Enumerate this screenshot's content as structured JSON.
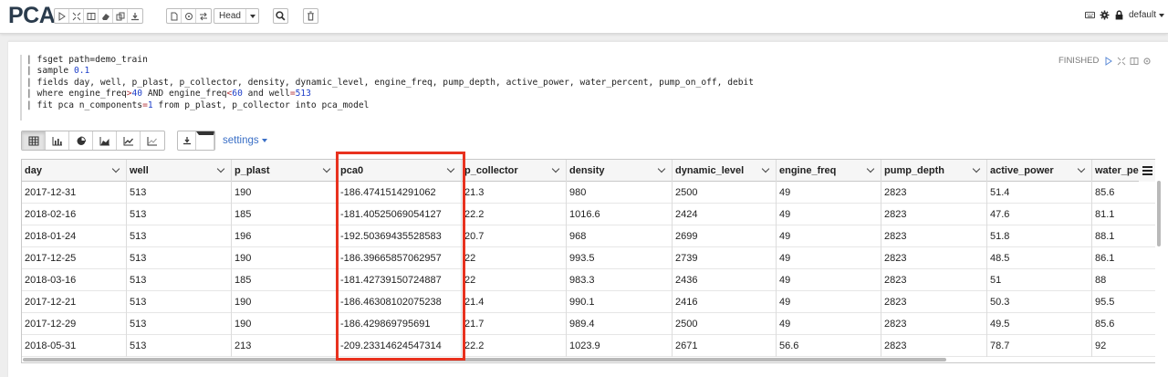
{
  "app": {
    "title": "PCA",
    "head_select": "Head",
    "default_select": "default"
  },
  "toolbar_icons": [
    "play-icon",
    "expand-icon",
    "book-icon",
    "eraser-icon",
    "copy-icon",
    "download-icon",
    "document-icon",
    "circle-icon",
    "swap-icon",
    "search-icon",
    "trash-icon"
  ],
  "right_icons": [
    "keyboard-icon",
    "gear-icon",
    "lock-icon"
  ],
  "paragraph": {
    "status": "FINISHED",
    "code_lines": [
      [
        {
          "t": "| fsget path=demo_train",
          "c": ""
        }
      ],
      [
        {
          "t": "| sample ",
          "c": ""
        },
        {
          "t": "0.1",
          "c": "num"
        }
      ],
      [
        {
          "t": "| fields day, well, p_plast, p_collector, density, dynamic_level, engine_freq, pump_depth, active_power, water_percent, pump_on_off, debit",
          "c": ""
        }
      ],
      [
        {
          "t": "| where engine_freq",
          "c": ""
        },
        {
          "t": ">",
          "c": "op"
        },
        {
          "t": "40",
          "c": "num"
        },
        {
          "t": " AND engine_freq",
          "c": ""
        },
        {
          "t": "<",
          "c": "op"
        },
        {
          "t": "60",
          "c": "num"
        },
        {
          "t": " and well",
          "c": ""
        },
        {
          "t": "=",
          "c": "op"
        },
        {
          "t": "513",
          "c": "num"
        }
      ],
      [
        {
          "t": "| fit pca n_components",
          "c": ""
        },
        {
          "t": "=",
          "c": "op"
        },
        {
          "t": "1",
          "c": "num"
        },
        {
          "t": " from p_plast, p_collector into pca_model",
          "c": ""
        }
      ]
    ],
    "settings_label": "settings"
  },
  "table": {
    "columns": [
      "day",
      "well",
      "p_plast",
      "pca0",
      "p_collector",
      "density",
      "dynamic_level",
      "engine_freq",
      "pump_depth",
      "active_power",
      "water_percent"
    ],
    "rows": [
      [
        "2017-12-31",
        "513",
        "190",
        "-186.4741514291062",
        "21.3",
        "980",
        "2500",
        "49",
        "2823",
        "51.4",
        "85.6"
      ],
      [
        "2018-02-16",
        "513",
        "185",
        "-181.40525069054127",
        "22.2",
        "1016.6",
        "2424",
        "49",
        "2823",
        "47.6",
        "81.1"
      ],
      [
        "2018-01-24",
        "513",
        "196",
        "-192.50369435528583",
        "20.7",
        "968",
        "2699",
        "49",
        "2823",
        "51.8",
        "88.1"
      ],
      [
        "2017-12-25",
        "513",
        "190",
        "-186.39665857062957",
        "22",
        "993.5",
        "2739",
        "49",
        "2823",
        "48.5",
        "86.1"
      ],
      [
        "2018-03-16",
        "513",
        "185",
        "-181.42739150724887",
        "22",
        "983.3",
        "2436",
        "49",
        "2823",
        "51",
        "88"
      ],
      [
        "2017-12-21",
        "513",
        "190",
        "-186.46308102075238",
        "21.4",
        "990.1",
        "2416",
        "49",
        "2823",
        "50.3",
        "95.5"
      ],
      [
        "2017-12-29",
        "513",
        "190",
        "-186.429869795691",
        "21.7",
        "989.4",
        "2500",
        "49",
        "2823",
        "49.5",
        "85.6"
      ],
      [
        "2018-05-31",
        "513",
        "213",
        "-209.23314624547314",
        "22.2",
        "1023.9",
        "2671",
        "56.6",
        "2823",
        "78.7",
        "92"
      ]
    ]
  }
}
